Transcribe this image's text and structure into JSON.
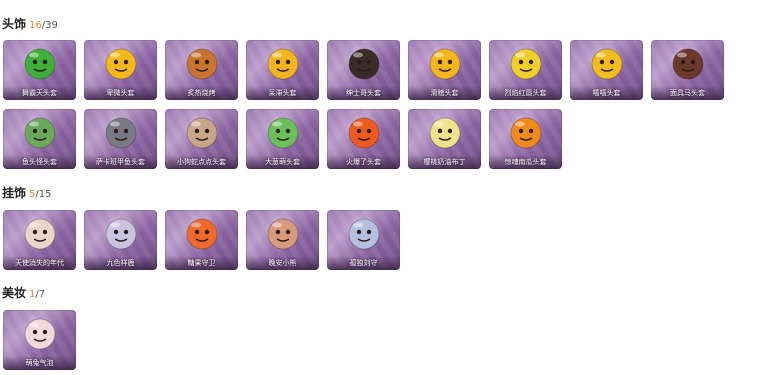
{
  "sections": [
    {
      "title": "头饰",
      "owned": "16",
      "total": "/39",
      "items": [
        {
          "label": "舞霸天头套",
          "icon": "green-dinosaur-icon",
          "color": "#3fae3a"
        },
        {
          "label": "卑微头套",
          "icon": "humble-emoji-icon",
          "color": "#f3b81b"
        },
        {
          "label": "炙热烧烤",
          "icon": "toast-bread-icon",
          "color": "#c9742d"
        },
        {
          "label": "呆滞头套",
          "icon": "dazed-emoji-icon",
          "color": "#f2b520"
        },
        {
          "label": "绅士哥头套",
          "icon": "sunglasses-dog-icon",
          "color": "#3a2c28"
        },
        {
          "label": "滑稽头套",
          "icon": "funny-emoji-icon",
          "color": "#f4b51e"
        },
        {
          "label": "烈焰红唇头套",
          "icon": "pikachu-sunglasses-icon",
          "color": "#f1cf2a"
        },
        {
          "label": "嘻嘻头套",
          "icon": "grin-emoji-icon",
          "color": "#f2bb1e"
        },
        {
          "label": "面具马头套",
          "icon": "horse-mask-icon",
          "color": "#6b3a2a"
        }
      ]
    },
    {
      "title": "",
      "owned": "",
      "total": "",
      "items": [
        {
          "label": "鱼头怪头套",
          "icon": "fish-monster-icon",
          "color": "#6aa85c"
        },
        {
          "label": "萨卡班甲鱼头套",
          "icon": "armored-fish-icon",
          "color": "#7a7a86"
        },
        {
          "label": "小狗蛇点点头套",
          "icon": "snake-dog-icon",
          "color": "#c9a58a"
        },
        {
          "label": "大葱萌头套",
          "icon": "scallion-icon",
          "color": "#6cc05a"
        },
        {
          "label": "火爆了头套",
          "icon": "fire-spirit-icon",
          "color": "#ef5a1e"
        },
        {
          "label": "樱桃奶油布丁",
          "icon": "pudding-icon",
          "color": "#f1e08c"
        },
        {
          "label": "惊魂南瓜头套",
          "icon": "pumpkin-icon",
          "color": "#f08a1c"
        }
      ]
    },
    {
      "title": "挂饰",
      "owned": "5",
      "total": "/15",
      "items": [
        {
          "label": "天使消失的年代",
          "icon": "angel-doll-icon",
          "color": "#e9d6c8"
        },
        {
          "label": "九色祥鹿",
          "icon": "deer-charm-icon",
          "color": "#c9c4e0"
        },
        {
          "label": "糖果守卫",
          "icon": "candy-guard-icon",
          "color": "#ef6a2a"
        },
        {
          "label": "晚安小熊",
          "icon": "bear-charm-icon",
          "color": "#d79a7a"
        },
        {
          "label": "孤独刘守",
          "icon": "lonely-doll-icon",
          "color": "#b6bfe0"
        }
      ]
    },
    {
      "title": "美妆",
      "owned": "1",
      "total": "/7",
      "items": [
        {
          "label": "萌兔气泡",
          "icon": "bunny-bubble-icon",
          "color": "#f0d9dd"
        }
      ]
    }
  ]
}
